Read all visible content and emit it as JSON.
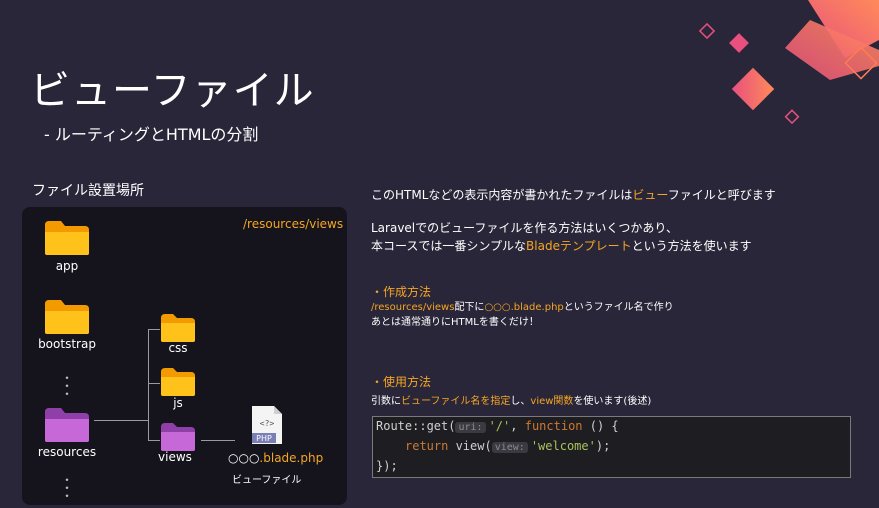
{
  "slide": {
    "title": "ビューファイル",
    "subtitle": "- ルーティングとHTMLの分割"
  },
  "left": {
    "section_label": "ファイル設置場所",
    "path": "/resources/views",
    "folders": {
      "app": "app",
      "bootstrap": "bootstrap",
      "resources": "resources",
      "css": "css",
      "js": "js",
      "views": "views"
    },
    "dots": "・\n・\n・",
    "file_badge": "PHP",
    "file_icon_text": "<?>",
    "file_name_prefix": "○○○",
    "file_name_suffix": ".blade.php",
    "file_caption": "ビューファイル"
  },
  "right": {
    "intro_pre": "このHTMLなどの表示内容が書かれたファイルは",
    "intro_hl": "ビュー",
    "intro_post": "ファイルと呼びます",
    "para2_line1": "Laravelでのビューファイルを作る方法はいくつかあり、",
    "para2_pre": "本コースでは一番シンプルな",
    "para2_hl": "Bladeテンプレート",
    "para2_post": "という方法を使います",
    "create_heading": "・作成方法",
    "create_path": "/resources/views",
    "create_mid": "配下に",
    "create_file": "○○○.blade.php",
    "create_post": "というファイル名で作り",
    "create_line2": "あとは通常通りにHTMLを書くだけ！",
    "use_heading": "・使用方法",
    "use_pre": "引数に",
    "use_hl1": "ビューファイル名を指定",
    "use_mid": "し、",
    "use_hl2": "view関数",
    "use_post": "を使います(後述)"
  },
  "code": {
    "l1_a": "Route::get(",
    "l1_hint": "uri:",
    "l1_str": "'/'",
    "l1_b": ", ",
    "l1_kw": "function",
    "l1_c": " () {",
    "l2_kw": "return",
    "l2_a": " view(",
    "l2_hint": "view:",
    "l2_str": "'welcome'",
    "l2_b": ");",
    "l3": "});"
  },
  "colors": {
    "background": "#2a2639",
    "accent": "#f5a623",
    "folder_yellow": "#f7b500",
    "folder_purple": "#b45dc8",
    "deco_pink": "#e8507e",
    "deco_orange": "#ff7b54"
  }
}
